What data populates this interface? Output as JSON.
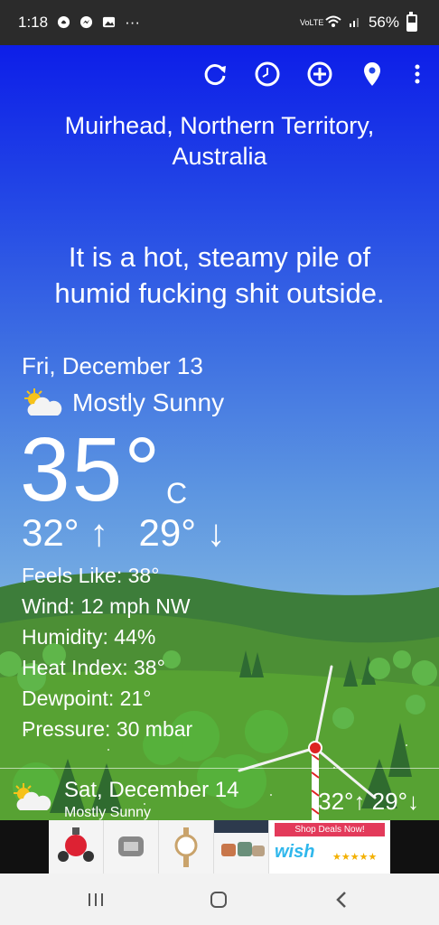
{
  "status_bar": {
    "time": "1:18",
    "icons": [
      "snapchat-icon",
      "messenger-icon",
      "gallery-icon",
      "more-notifications-icon"
    ],
    "more": "···",
    "network": "VoLTE",
    "battery": "56%"
  },
  "toolbar": {
    "icons": [
      "refresh-icon",
      "history-icon",
      "add-icon",
      "location-pin-icon",
      "overflow-menu-icon"
    ]
  },
  "location": {
    "line1": "Muirhead, Northern Territory,",
    "line2": "Australia"
  },
  "tagline": {
    "line1": "It is a hot, steamy pile of",
    "line2": "humid fucking shit outside."
  },
  "current": {
    "date": "Fri, December 13",
    "condition": "Mostly Sunny",
    "condition_icon": "partly-sunny-icon",
    "temp": "35°",
    "unit": "C",
    "high": "32°",
    "low": "29°",
    "up_arrow": "↑",
    "down_arrow": "↓",
    "details": [
      "Feels Like: 38°",
      "Wind: 12 mph NW",
      "Humidity: 44%",
      "Heat Index: 38°",
      "Dewpoint: 21°",
      "Pressure: 30 mbar"
    ]
  },
  "forecast": [
    {
      "date": "Sat, December 14",
      "condition": "Mostly Sunny",
      "icon": "partly-sunny-icon",
      "high": "32°",
      "low": "29°",
      "up_arrow": "↑",
      "down_arrow": "↓"
    }
  ],
  "ad": {
    "shop_label": "Shop Deals Now!",
    "brand": "wish",
    "stars": "★★★★★"
  },
  "colors": {
    "sky_top": "#0d1ee8",
    "sky_bottom": "#a0cde8",
    "hill": "#3f8f3a",
    "grass": "#4f9c32"
  }
}
